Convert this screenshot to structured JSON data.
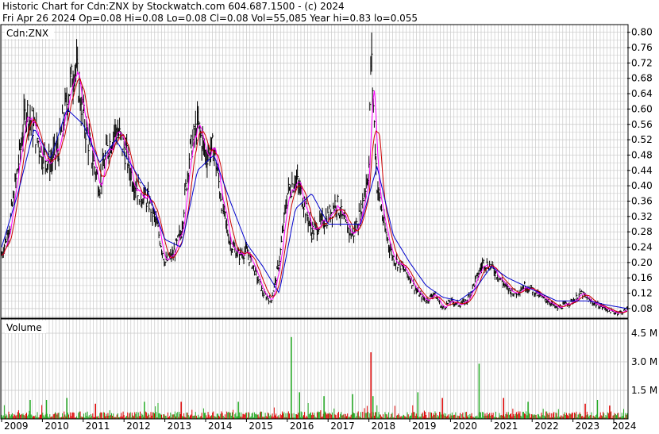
{
  "header": {
    "line1": "Historic Chart for Cdn:ZNX by Stockwatch.com 604.687.1500 - (c) 2024",
    "line2": "Fri Apr 26 2024   Op=0.08  Hi=0.08  Lo=0.08  Cl=0.08  Vol=55,085  Year hi=0.83  lo=0.055"
  },
  "colors": {
    "background": "#ffffff",
    "grid": "#c8c8c8",
    "frame": "#000000",
    "price_bars": "#000000",
    "ma_short": "#ff00ff",
    "ma_mid": "#cc0000",
    "ma_long": "#0000cc",
    "volume_up": "#22aa22",
    "volume_down": "#dd0000"
  },
  "chart_data": [
    {
      "type": "line",
      "title": "Cdn:ZNX",
      "y_axis": {
        "ylim": [
          0.055,
          0.82
        ],
        "ticks": [
          "0.80",
          "0.76",
          "0.72",
          "0.68",
          "0.64",
          "0.60",
          "0.56",
          "0.52",
          "0.48",
          "0.44",
          "0.40",
          "0.36",
          "0.32",
          "0.28",
          "0.24",
          "0.20",
          "0.16",
          "0.12",
          "0.08"
        ],
        "position": "right"
      },
      "x_axis": {
        "xlim": [
          2009.0,
          2024.33
        ]
      },
      "grid": true,
      "series": [
        {
          "role": "price_close",
          "x": [
            2009.0,
            2009.2,
            2009.4,
            2009.6,
            2009.8,
            2010.0,
            2010.2,
            2010.4,
            2010.6,
            2010.8,
            2011.0,
            2011.2,
            2011.4,
            2011.6,
            2011.8,
            2012.0,
            2012.2,
            2012.4,
            2012.6,
            2012.8,
            2013.0,
            2013.2,
            2013.4,
            2013.6,
            2013.8,
            2014.0,
            2014.2,
            2014.4,
            2014.6,
            2014.8,
            2015.0,
            2015.2,
            2015.4,
            2015.6,
            2015.8,
            2016.0,
            2016.2,
            2016.4,
            2016.6,
            2016.8,
            2017.0,
            2017.2,
            2017.4,
            2017.6,
            2017.8,
            2018.0,
            2018.05,
            2018.2,
            2018.4,
            2018.6,
            2018.8,
            2019.0,
            2019.2,
            2019.4,
            2019.6,
            2019.8,
            2020.0,
            2020.2,
            2020.4,
            2020.6,
            2020.8,
            2021.0,
            2021.2,
            2021.4,
            2021.6,
            2021.8,
            2022.0,
            2022.2,
            2022.4,
            2022.6,
            2022.8,
            2023.0,
            2023.2,
            2023.4,
            2023.6,
            2023.8,
            2024.0,
            2024.2,
            2024.33
          ],
          "y": [
            0.22,
            0.3,
            0.45,
            0.6,
            0.55,
            0.48,
            0.46,
            0.5,
            0.62,
            0.72,
            0.58,
            0.48,
            0.4,
            0.5,
            0.55,
            0.5,
            0.42,
            0.38,
            0.36,
            0.3,
            0.2,
            0.22,
            0.28,
            0.48,
            0.56,
            0.48,
            0.5,
            0.35,
            0.25,
            0.22,
            0.23,
            0.18,
            0.12,
            0.1,
            0.2,
            0.38,
            0.42,
            0.36,
            0.28,
            0.3,
            0.32,
            0.36,
            0.3,
            0.27,
            0.33,
            0.45,
            0.75,
            0.4,
            0.28,
            0.21,
            0.19,
            0.16,
            0.12,
            0.1,
            0.12,
            0.08,
            0.1,
            0.09,
            0.1,
            0.15,
            0.2,
            0.19,
            0.16,
            0.13,
            0.12,
            0.14,
            0.13,
            0.11,
            0.1,
            0.08,
            0.09,
            0.1,
            0.12,
            0.1,
            0.09,
            0.08,
            0.07,
            0.07,
            0.08
          ]
        },
        {
          "role": "ma_long",
          "x": [
            2009.0,
            2009.4,
            2009.8,
            2010.2,
            2010.6,
            2011.0,
            2011.4,
            2011.8,
            2012.2,
            2012.6,
            2013.0,
            2013.4,
            2013.8,
            2014.2,
            2014.6,
            2015.0,
            2015.4,
            2015.8,
            2016.2,
            2016.6,
            2017.0,
            2017.4,
            2017.8,
            2018.2,
            2018.6,
            2019.0,
            2019.4,
            2019.8,
            2020.2,
            2020.6,
            2021.0,
            2021.4,
            2021.8,
            2022.2,
            2022.6,
            2023.0,
            2023.4,
            2023.8,
            2024.33
          ],
          "y": [
            0.24,
            0.38,
            0.55,
            0.47,
            0.6,
            0.56,
            0.46,
            0.52,
            0.45,
            0.38,
            0.26,
            0.24,
            0.44,
            0.48,
            0.36,
            0.25,
            0.19,
            0.12,
            0.34,
            0.38,
            0.3,
            0.3,
            0.3,
            0.45,
            0.27,
            0.2,
            0.14,
            0.11,
            0.1,
            0.13,
            0.19,
            0.16,
            0.14,
            0.12,
            0.1,
            0.1,
            0.1,
            0.09,
            0.08
          ]
        }
      ]
    },
    {
      "type": "bar",
      "title": "Volume",
      "y_axis": {
        "ylim": [
          0,
          5.0
        ],
        "ticks": [
          "4.5 M",
          "3.0 M",
          "1.5 M"
        ],
        "position": "right"
      },
      "x_axis": {
        "ticks": [
          "2009",
          "2010",
          "2011",
          "2012",
          "2013",
          "2014",
          "2015",
          "2016",
          "2017",
          "2018",
          "2019",
          "2020",
          "2021",
          "2022",
          "2023",
          "2024"
        ]
      },
      "spikes": {
        "x": [
          2009.7,
          2010.1,
          2010.6,
          2011.3,
          2012.5,
          2013.4,
          2014.8,
          2016.1,
          2016.3,
          2016.9,
          2017.6,
          2018.05,
          2018.1,
          2019.2,
          2019.8,
          2020.7,
          2021.3,
          2021.9,
          2023.3,
          2023.6,
          2023.9
        ],
        "values": [
          1.0,
          1.0,
          1.1,
          0.8,
          0.9,
          0.9,
          0.9,
          4.3,
          1.4,
          1.2,
          1.3,
          3.5,
          1.2,
          1.4,
          1.1,
          2.9,
          1.1,
          0.9,
          0.8,
          1.0,
          0.7
        ],
        "colors": [
          "g",
          "g",
          "g",
          "r",
          "g",
          "r",
          "g",
          "g",
          "g",
          "g",
          "g",
          "r",
          "g",
          "g",
          "r",
          "g",
          "r",
          "g",
          "r",
          "g",
          "r"
        ]
      }
    }
  ]
}
